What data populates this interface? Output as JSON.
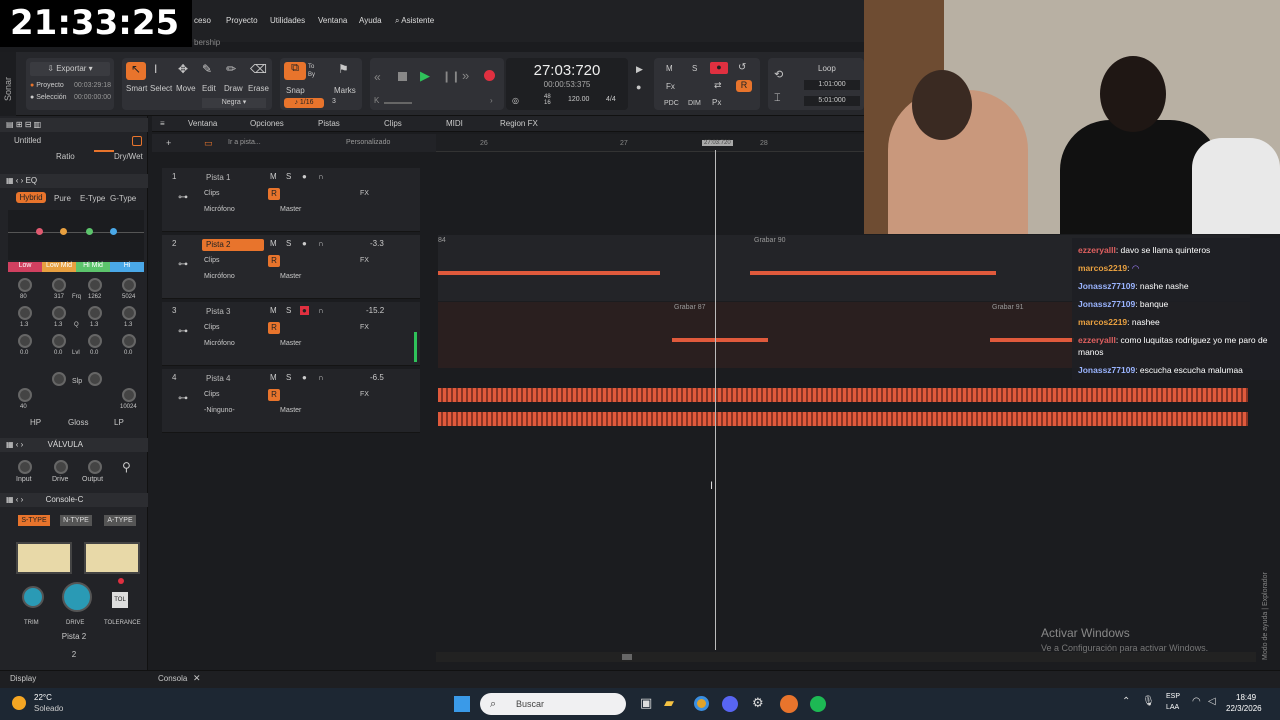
{
  "clock": "21:33:25",
  "menu": [
    "ceso",
    "Proyecto",
    "Utilidades",
    "Ventana",
    "Ayuda",
    "Asistente"
  ],
  "menu_sub": "bership",
  "control": {
    "export": "Exportar",
    "project": "Proyecto",
    "project_time": "00:03:29:18",
    "selection": "Selección",
    "selection_time": "00:00:00:00",
    "tools": [
      "Smart",
      "Select",
      "Move",
      "Edit",
      "Draw",
      "Erase"
    ],
    "color_label": "Negra",
    "snap": "Snap",
    "snap_val": "1/16",
    "snap_num": "3",
    "markers": "Marks",
    "to_label": "To",
    "by_label": "By",
    "time_main": "27:03:720",
    "time_sub": "00:00:53:375",
    "tempo_top": "48",
    "tempo_bot": "16",
    "tempo": "120.00",
    "meter": "4/4",
    "loop": "Loop",
    "loop_start": "1:01:000",
    "loop_end": "5:01:000",
    "m": "M",
    "s": "S",
    "r": "R",
    "fx": "Fx",
    "pdc": "PDC",
    "dim": "DIM",
    "px": "Px"
  },
  "inspector": {
    "title": "Untitled",
    "ratio": "Ratio",
    "drywet": "Dry/Wet",
    "eq": "EQ",
    "eq_modes": [
      "Hybrid",
      "Pure",
      "E-Type",
      "G-Type"
    ],
    "bands": [
      "Low",
      "Low Mid",
      "Hi Mid",
      "Hi"
    ],
    "band_vals1": [
      "80",
      "317",
      "1262",
      "5024"
    ],
    "freq": "Frq",
    "q_vals": [
      "1.3",
      "1.3",
      "1.3",
      "1.3"
    ],
    "q_label": "Q",
    "lvl_vals": [
      "0.0",
      "0.0",
      "0.0",
      "0.0"
    ],
    "lvl_label": "Lvl",
    "slp": "Slp",
    "hp_val": "40",
    "lp_val": "10024",
    "filters": [
      "HP",
      "Gloss",
      "LP"
    ],
    "valve": "VÁLVULA",
    "valve_knobs": [
      "Input",
      "Drive",
      "Output"
    ],
    "console": "Console-C",
    "types": [
      "S-TYPE",
      "N-TYPE",
      "A-TYPE"
    ],
    "console_knobs": [
      "TRIM",
      "DRIVE",
      "TOLERANCE"
    ],
    "tol": "TOL",
    "track_name": "Pista 2",
    "track_num": "2",
    "display": "Display"
  },
  "trackview": {
    "menu": [
      "Ventana",
      "Opciones",
      "Pistas",
      "Clips",
      "MIDI",
      "Region FX"
    ],
    "goto": "Ir a pista...",
    "custom": "Personalizado",
    "ruler": [
      "26",
      "27",
      "27:03:720",
      "28"
    ],
    "tracks": [
      {
        "num": "1",
        "name": "Pista 1",
        "clips": "Clips",
        "input": "Micrófono",
        "output": "Master",
        "vol": "",
        "armed": false
      },
      {
        "num": "2",
        "name": "Pista 2",
        "clips": "Clips",
        "input": "Micrófono",
        "output": "Master",
        "vol": "-3.3",
        "armed": false
      },
      {
        "num": "3",
        "name": "Pista 3",
        "clips": "Clips",
        "input": "Micrófono",
        "output": "Master",
        "vol": "-15.2",
        "armed": true
      },
      {
        "num": "4",
        "name": "Pista 4",
        "clips": "Clips",
        "input": "-Ninguno-",
        "output": "Master",
        "vol": "-6.5",
        "armed": false
      }
    ],
    "clips": {
      "t2a": "84",
      "t2b": "Grabar 90",
      "t3a": "Grabar 87",
      "t3b": "Grabar 91"
    },
    "fx": "FX",
    "console_tab": "Consola"
  },
  "chat": [
    {
      "user": "ezzeryalll",
      "cls": "u1",
      "msg": ": davo se llama quinteros"
    },
    {
      "user": "marcos2219",
      "cls": "u2",
      "msg": ": "
    },
    {
      "user": "Jonassz77109",
      "cls": "u3",
      "msg": ": nashe nashe"
    },
    {
      "user": "Jonassz77109",
      "cls": "u3",
      "msg": ": banque"
    },
    {
      "user": "marcos2219",
      "cls": "u2",
      "msg": ": nashee"
    },
    {
      "user": "ezzeryalll",
      "cls": "u1",
      "msg": ": como luquitas rodriguez yo me paro de manos"
    },
    {
      "user": "Jonassz77109",
      "cls": "u3",
      "msg": ": escucha escucha malumaa"
    }
  ],
  "watermark": {
    "title": "Activar Windows",
    "sub": "Ve a Configuración para activar Windows."
  },
  "side_label": "Modo de ayuda | Explorador",
  "taskbar": {
    "weather_temp": "22°C",
    "weather": "Soleado",
    "search": "Buscar",
    "lang": "ESP",
    "lang2": "LAA",
    "time": "18:49",
    "date": "22/3/2026"
  },
  "colors": {
    "accent": "#e8742c",
    "wave": "#e05a3c"
  }
}
